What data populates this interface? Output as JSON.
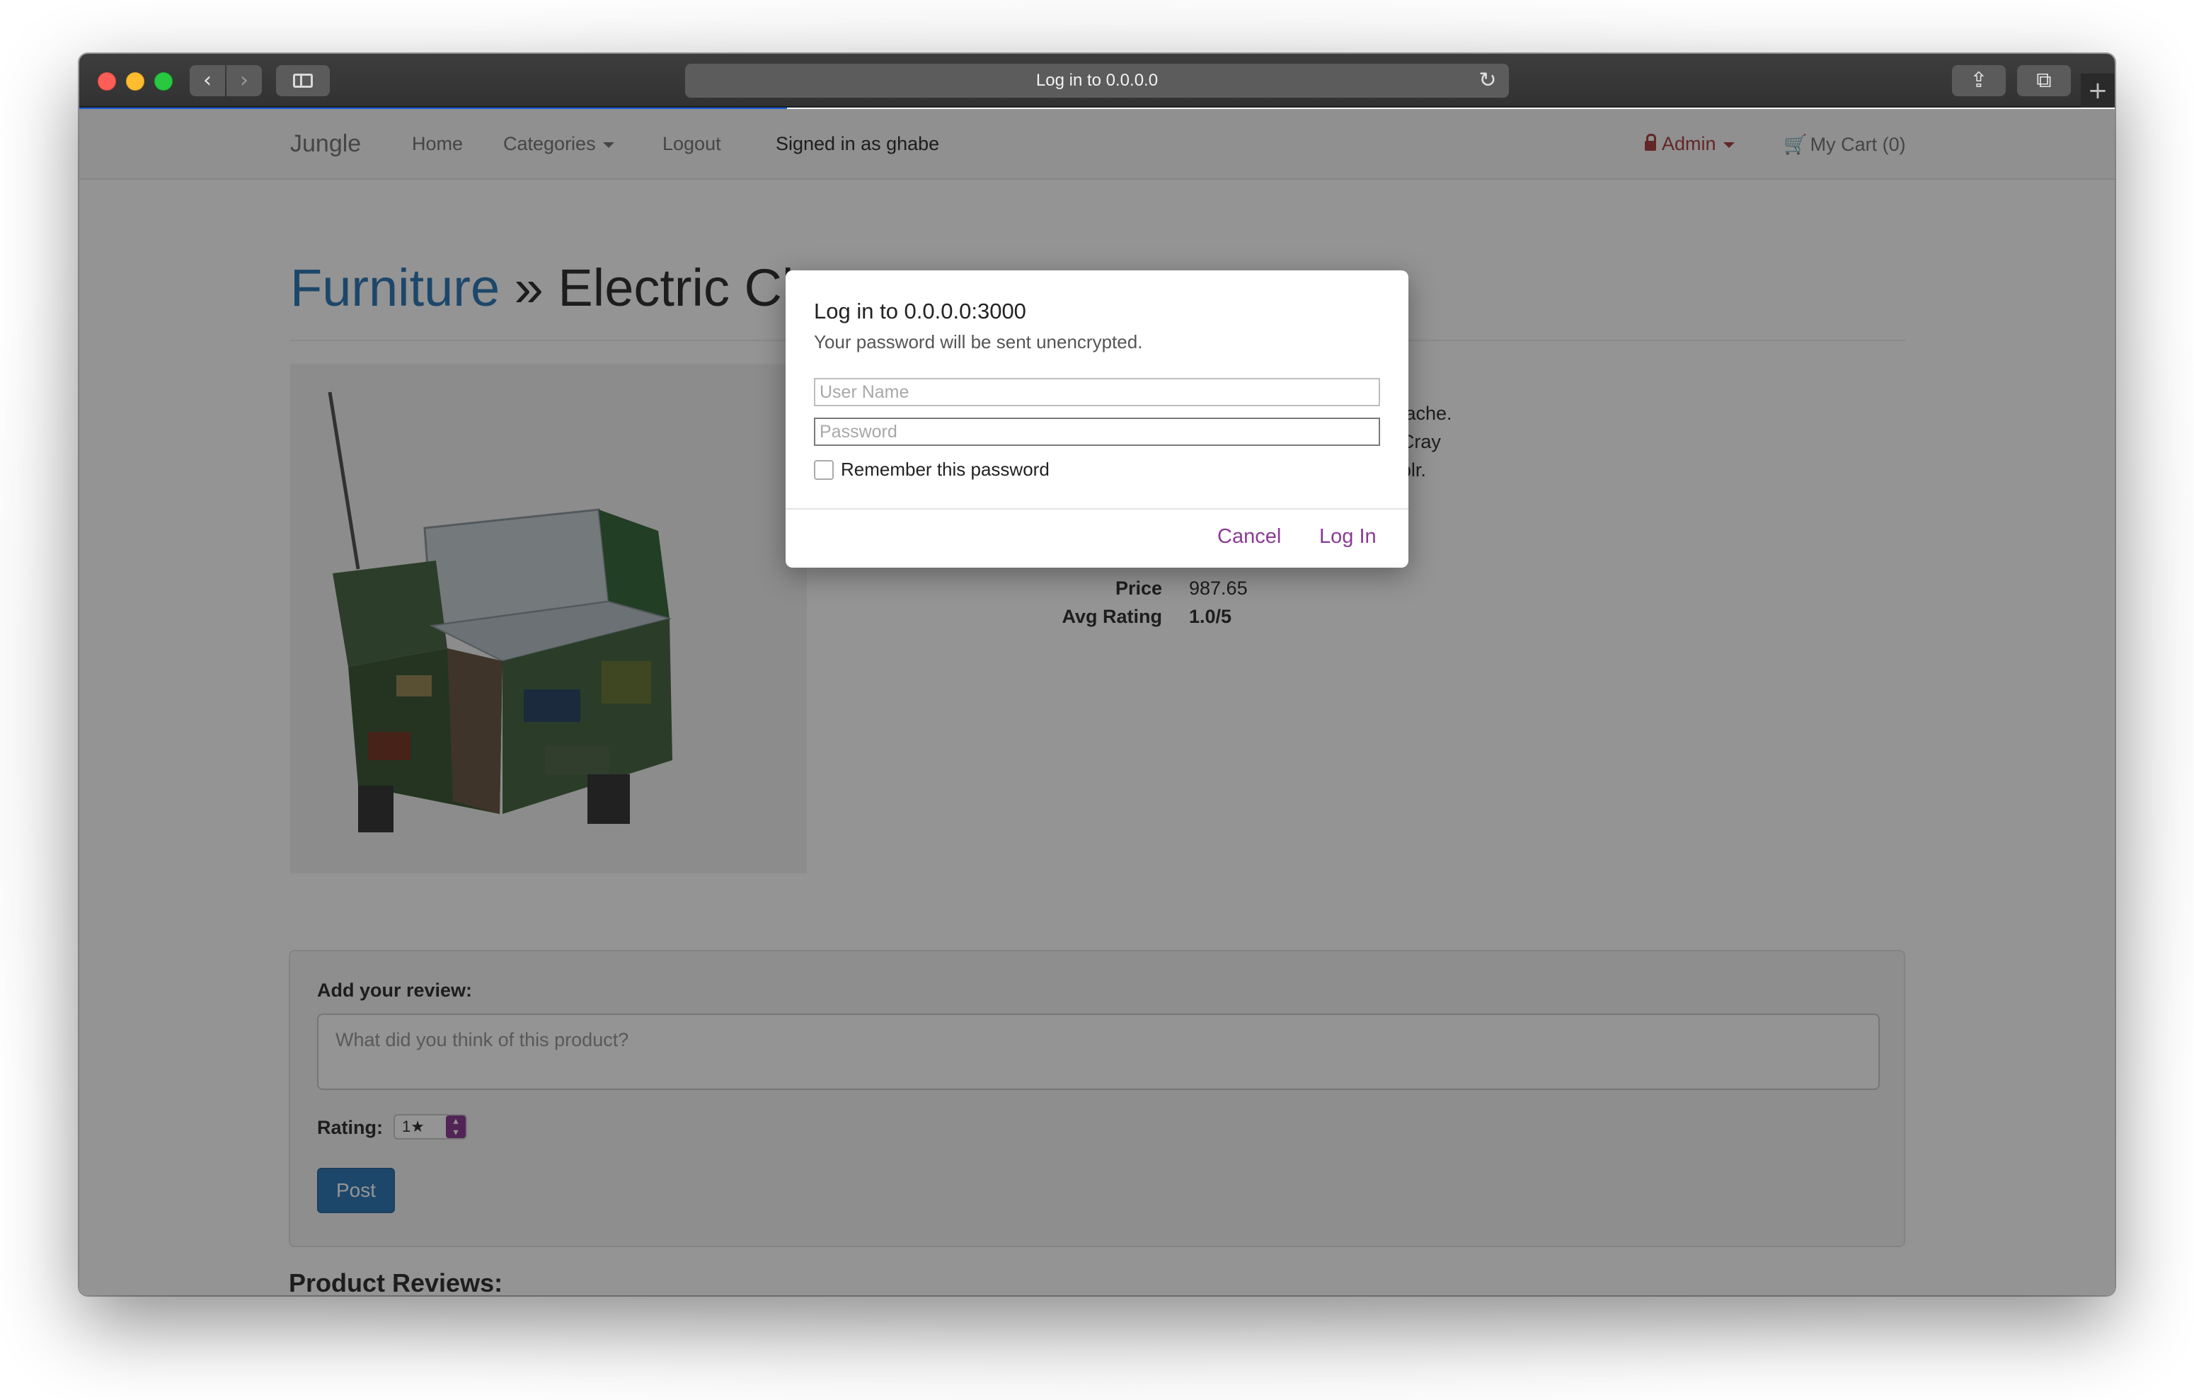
{
  "browser": {
    "url_title": "Log in to 0.0.0.0",
    "back_icon": "‹",
    "forward_icon": "›",
    "reload_icon": "↻",
    "share_icon": "⇪",
    "tabs_icon": "⧉",
    "newtab_icon": "+"
  },
  "navbar": {
    "brand": "Jungle",
    "home": "Home",
    "categories": "Categories",
    "logout": "Logout",
    "signed_in": "Signed in as ghabe",
    "admin": "Admin",
    "cart_icon": "🛒",
    "cart": "My Cart (0)"
  },
  "product": {
    "category": "Furniture",
    "separator": "»",
    "name_visible": "Electric Cl",
    "description_lines": [
      "etsy you probably haven't heard of them fingerstache.",
      "e. Irony blue bottle knausgaard hashtag migas. Cray",
      "ape humblebrag cleanse hoodie kombucha tumblr."
    ],
    "price_label": "Price",
    "price": "987.65",
    "rating_label": "Avg Rating",
    "rating": "1.0/5"
  },
  "review_form": {
    "title": "Add your review:",
    "placeholder": "What did you think of this product?",
    "rating_label": "Rating:",
    "rating_value": "1★",
    "post": "Post"
  },
  "reviews": {
    "title": "Product Reviews:"
  },
  "dialog": {
    "title": "Log in to 0.0.0.0:3000",
    "subtitle": "Your password will be sent unencrypted.",
    "username_placeholder": "User Name",
    "password_placeholder": "Password",
    "remember": "Remember this password",
    "cancel": "Cancel",
    "login": "Log In"
  },
  "colors": {
    "link_blue": "#337ab7",
    "admin_red": "#a94442",
    "dialog_accent": "#8a3a96",
    "progress_blue": "#1a5cd8"
  }
}
